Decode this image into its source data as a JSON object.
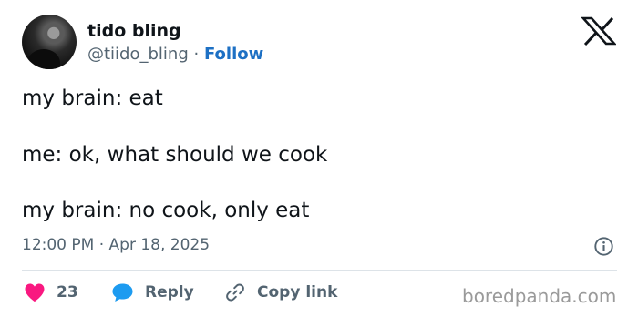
{
  "author": {
    "display_name": "tido bling",
    "handle": "@tiido_bling",
    "separator": "·",
    "follow_label": "Follow",
    "avatar_icon": "profile-photo"
  },
  "platform_icon": "x-logo-icon",
  "tweet": {
    "lines": [
      "my brain: eat",
      "me: ok, what should we cook",
      "my brain: no cook, only eat"
    ]
  },
  "timestamp": "12:00 PM · Apr 18, 2025",
  "actions": {
    "like_count": "23",
    "reply_label": "Reply",
    "copy_link_label": "Copy link"
  },
  "colors": {
    "like_heart": "#f91880",
    "reply_bubble": "#1d9bf0",
    "follow_link": "#1d70c4"
  },
  "watermark": "boredpanda.com"
}
